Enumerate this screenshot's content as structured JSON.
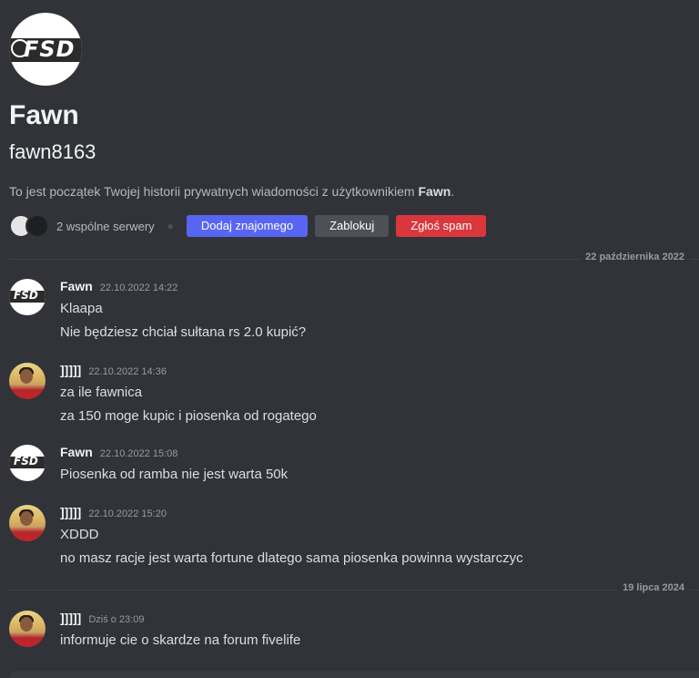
{
  "profile": {
    "logo_text": "FSD",
    "display_name": "Fawn",
    "username": "fawn8163",
    "intro_prefix": "To jest początek Twojej historii prywatnych wiadomości z użytkownikiem ",
    "intro_name": "Fawn",
    "intro_suffix": ".",
    "mutual_servers": "2 wspólne serwery",
    "add_friend": "Dodaj znajomego",
    "block": "Zablokuj",
    "report_spam": "Zgłoś spam"
  },
  "dividers": {
    "first": "22 października 2022",
    "second": "19 lipca 2024"
  },
  "messages": [
    {
      "author": "Fawn",
      "timestamp": "22.10.2022 14:22",
      "lines": [
        "Klaapa",
        "Nie będziesz chciał sułtana rs 2.0 kupić?"
      ]
    },
    {
      "author": "]]]]]",
      "timestamp": "22.10.2022 14:36",
      "lines": [
        "za ile fawnica",
        "za 150 moge kupic i piosenka od rogatego"
      ]
    },
    {
      "author": "Fawn",
      "timestamp": "22.10.2022 15:08",
      "lines": [
        "Piosenka od ramba nie jest warta 50k"
      ]
    },
    {
      "author": "]]]]]",
      "timestamp": "22.10.2022 15:20",
      "lines": [
        "XDDD",
        "no masz racje  jest warta fortune dlatego sama piosenka powinna wystarczyc"
      ]
    },
    {
      "author": "]]]]]",
      "timestamp": "Dziś o 23:09",
      "lines": [
        "informuje cie o skardze na forum fivelife"
      ]
    }
  ]
}
